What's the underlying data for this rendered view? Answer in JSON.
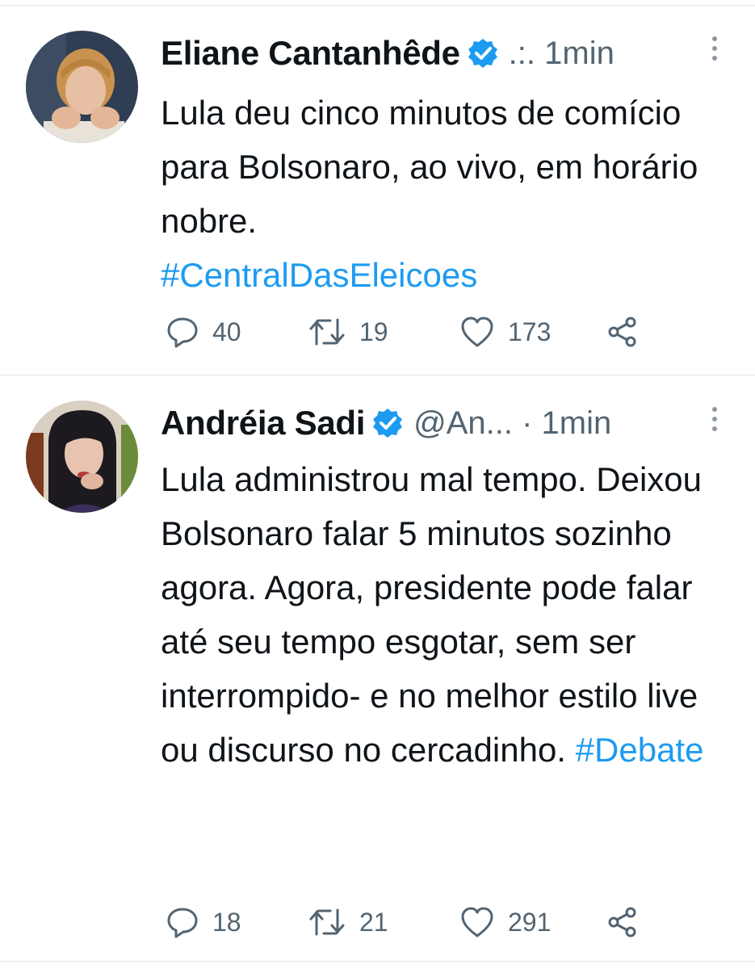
{
  "tweets": [
    {
      "author": "Eliane Cantanhêde",
      "meta": ".:. 1min",
      "text": "Lula deu cinco minutos de comício para Bolsonaro, ao vivo, em horário nobre.",
      "hashtag": "#CentralDasEleicoes",
      "reply_count": "40",
      "retweet_count": "19",
      "like_count": "173"
    },
    {
      "author": "Andréia Sadi",
      "meta": "@An... · 1min",
      "text": "Lula administrou mal tempo. Deixou Bolsonaro falar 5 minutos sozinho agora. Agora, presidente pode falar até seu tempo esgotar, sem ser interrompido- e no melhor estilo live ou discurso no cercadinho.",
      "hashtag": "#Debate",
      "reply_count": "18",
      "retweet_count": "21",
      "like_count": "291"
    }
  ],
  "icons": {
    "verified": "verified-badge-icon",
    "more": "more-options-icon",
    "reply": "reply-icon",
    "retweet": "retweet-icon",
    "like": "like-icon",
    "share": "share-icon"
  },
  "colors": {
    "text": "#0f1419",
    "secondary": "#536471",
    "hashtag": "#1d9bf0",
    "verified": "#1d9bf0",
    "divider": "#e2e5e8"
  }
}
